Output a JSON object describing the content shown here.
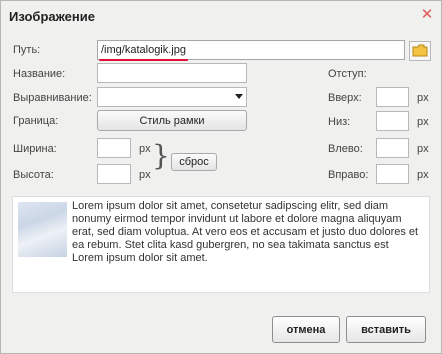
{
  "dialog": {
    "title": "Изображение"
  },
  "fields": {
    "path_label": "Путь:",
    "path_value": "/img/katalogik.jpg",
    "name_label": "Название:",
    "name_value": "",
    "align_label": "Выравнивание:",
    "align_value": "",
    "border_label": "Граница:",
    "border_button": "Стиль рамки",
    "width_label": "Ширина:",
    "height_label": "Высота:",
    "reset_button": "сброс",
    "px": "px"
  },
  "offsets": {
    "label": "Отступ:",
    "top_label": "Вверх:",
    "bottom_label": "Низ:",
    "left_label": "Влево:",
    "right_label": "Вправо:"
  },
  "preview": {
    "text": "Lorem ipsum dolor sit amet, consetetur sadipscing elitr, sed diam nonumy eirmod tempor invidunt ut labore et dolore magna aliquyam erat, sed diam voluptua. At vero eos et accusam et justo duo dolores et ea rebum. Stet clita kasd gubergren, no sea takimata sanctus est Lorem ipsum dolor sit amet."
  },
  "footer": {
    "cancel_label": "отмена",
    "insert_label": "вставить"
  },
  "colors": {
    "underline": "#e0103a",
    "close": "#e05a5a"
  }
}
